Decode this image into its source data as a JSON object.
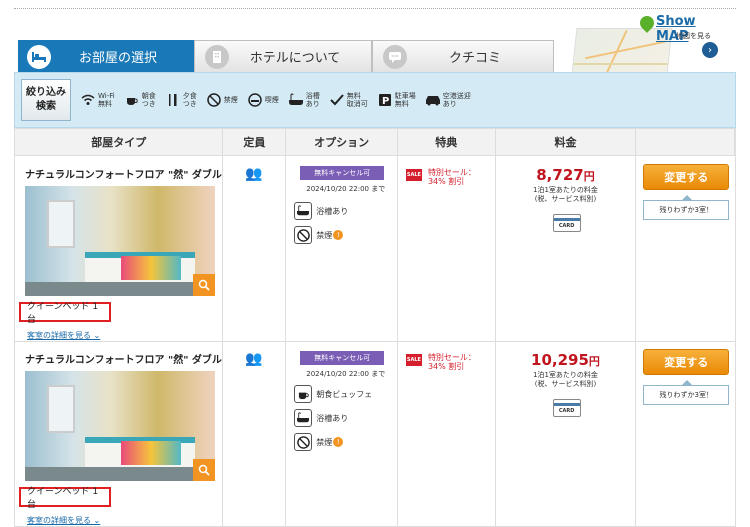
{
  "tabs": [
    {
      "label": "お部屋の選択",
      "icon": "bed-icon",
      "active": true
    },
    {
      "label": "ホテルについて",
      "icon": "building-icon",
      "active": false
    },
    {
      "label": "クチコミ",
      "icon": "chat-icon",
      "active": false
    }
  ],
  "map": {
    "title": "Show MAP",
    "subtitle": "地図を見る"
  },
  "filter": {
    "button": "絞り込み\n検索",
    "items": [
      {
        "icon": "wifi-icon",
        "label": "Wi-Fi\n無料"
      },
      {
        "icon": "breakfast-icon",
        "label": "朝食\nつき"
      },
      {
        "icon": "dinner-icon",
        "label": "夕食\nつき"
      },
      {
        "icon": "no-smoking-icon",
        "label": "禁煙"
      },
      {
        "icon": "smoking-icon",
        "label": "喫煙"
      },
      {
        "icon": "bath-icon",
        "label": "浴槽\nあり"
      },
      {
        "icon": "checkmark-icon",
        "label": "無料\n取消可"
      },
      {
        "icon": "parking-icon",
        "label": "駐車場\n無料"
      },
      {
        "icon": "car-icon",
        "label": "空港送迎\nあり"
      }
    ]
  },
  "headers": [
    "部屋タイプ",
    "定員",
    "オプション",
    "特典",
    "料金",
    ""
  ],
  "rooms": [
    {
      "name": "ナチュラルコンフォートフロア \"然\" ダブル",
      "bed": "クイーンベッド 1 台",
      "detail_link": "客室の詳細を見る",
      "cancel_badge": "無料キャンセル可",
      "cancel_until": "2024/10/20 22:00 まで",
      "options": [
        {
          "icon": "bath-icon",
          "label": "浴槽あり",
          "warn": false
        },
        {
          "icon": "no-smoking-icon",
          "label": "禁煙",
          "warn": true
        }
      ],
      "sale_badge": "SALE",
      "sale_text": "特別セール：\n34% 割引",
      "price": "8,727",
      "currency": "円",
      "price_note": "1泊1室あたりの料金\n(税、サービス料別)",
      "card_label": "CARD",
      "button": "変更する",
      "remaining": "残りわずか3室！"
    },
    {
      "name": "ナチュラルコンフォートフロア \"然\" ダブル",
      "bed": "クイーンベッド 1 台",
      "detail_link": "客室の詳細を見る",
      "cancel_badge": "無料キャンセル可",
      "cancel_until": "2024/10/20 22:00 まで",
      "options": [
        {
          "icon": "breakfast-icon",
          "label": "朝食ビュッフェ",
          "warn": false
        },
        {
          "icon": "bath-icon",
          "label": "浴槽あり",
          "warn": false
        },
        {
          "icon": "no-smoking-icon",
          "label": "禁煙",
          "warn": true
        }
      ],
      "sale_badge": "SALE",
      "sale_text": "特別セール：\n34% 割引",
      "price": "10,295",
      "currency": "円",
      "price_note": "1泊1室あたりの料金\n(税、サービス料別)",
      "card_label": "CARD",
      "button": "変更する",
      "remaining": "残りわずか3室！"
    }
  ]
}
